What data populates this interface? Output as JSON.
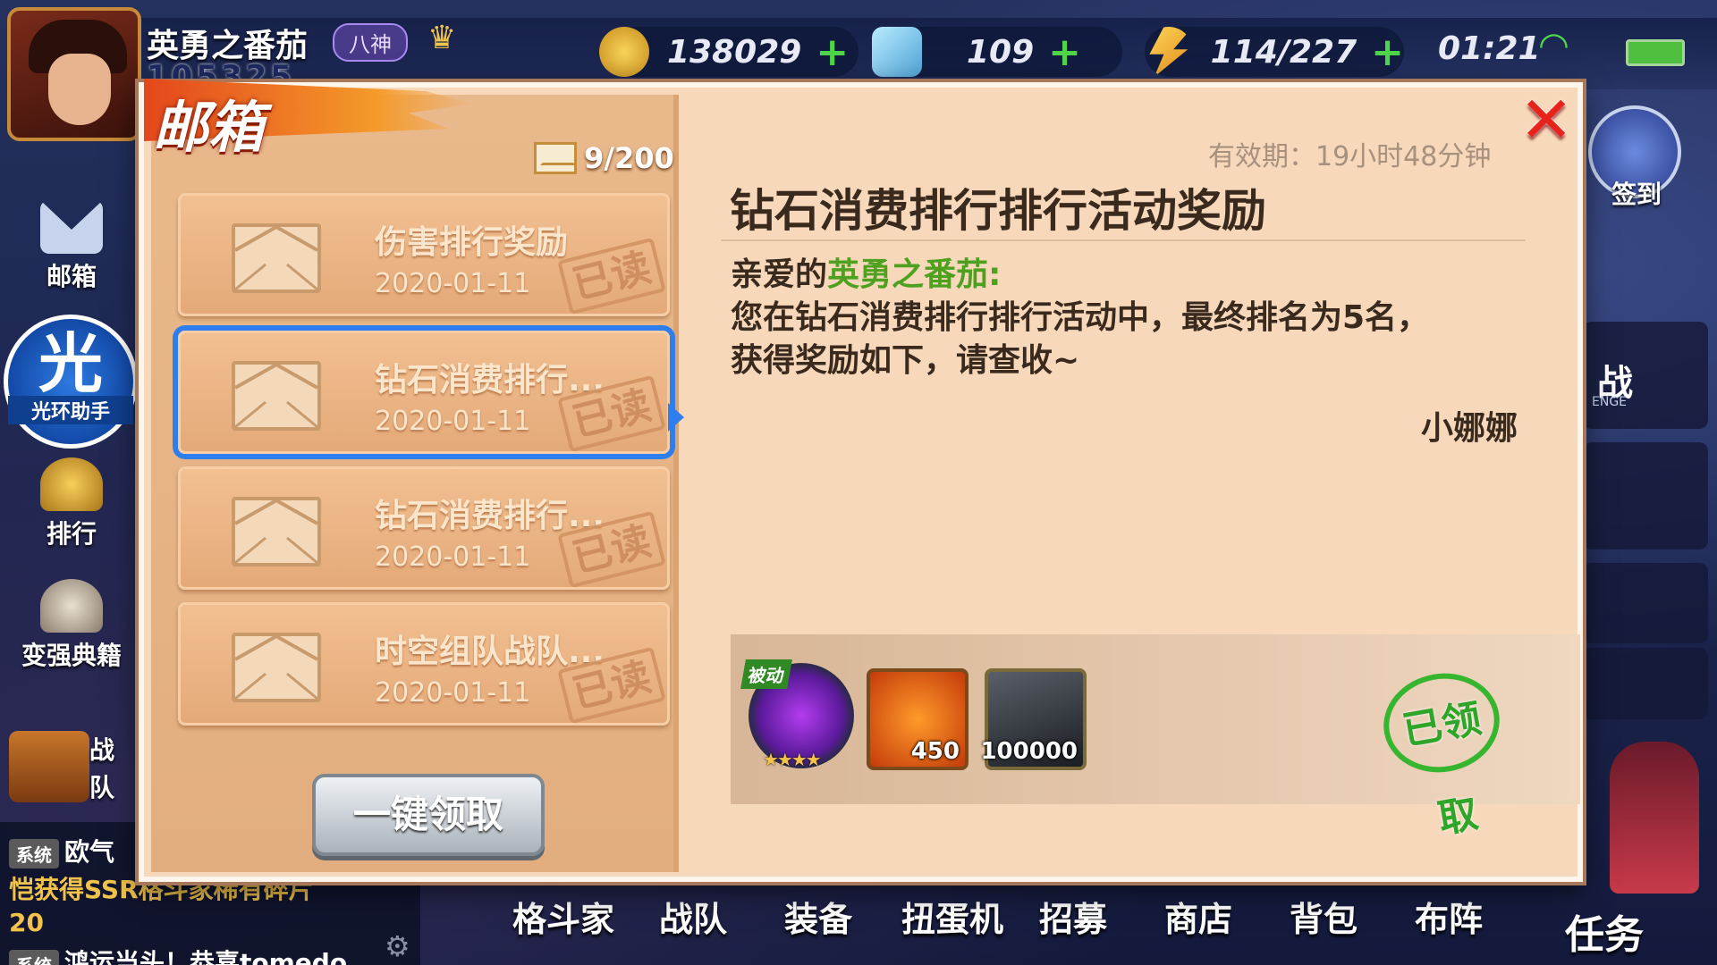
{
  "status_bar": {
    "player_name": "英勇之番茄",
    "vip_badge": "八神",
    "level_text": "105325",
    "gold": "138029",
    "diamond": "109",
    "stamina": "114/227",
    "plus": "+",
    "time": "01:21"
  },
  "sidebar": {
    "mailbox": "邮箱",
    "halo_big": "光",
    "halo_label": "光环助手",
    "ranking": "排行",
    "guide": "变强典籍",
    "battle": "战",
    "team": "队"
  },
  "right_side": {
    "signin": "签到",
    "challenge": "战",
    "challenge_sub": "ENGE",
    "task": "任务"
  },
  "chat": {
    "sys1_tag": "系统",
    "sys1_text": "欧气",
    "line2": "恺获得SSR格斗家稀有碎片",
    "line3": "20",
    "sys2_tag": "系统",
    "sys2_text": "鸿运当头！恭喜tomedo"
  },
  "bottom_nav": [
    "格斗家",
    "战队",
    "装备",
    "扭蛋机",
    "招募",
    "商店",
    "背包",
    "布阵"
  ],
  "dialog": {
    "header": "邮箱",
    "mail_count": "9/200",
    "claim_all": "一键领取",
    "close_icon": "✕",
    "mails": [
      {
        "title": "伤害排行奖励",
        "date": "2020-01-11",
        "status": "已读"
      },
      {
        "title": "钻石消费排行...",
        "date": "2020-01-11",
        "status": "已读"
      },
      {
        "title": "钻石消费排行...",
        "date": "2020-01-11",
        "status": "已读"
      },
      {
        "title": "时空组队战队...",
        "date": "2020-01-11",
        "status": "已读"
      }
    ],
    "detail": {
      "expiry": "有效期：19小时48分钟",
      "title": "钻石消费排行排行活动奖励",
      "greeting_prefix": "亲爱的",
      "greeting_name": "英勇之番茄",
      "greeting_suffix": ":",
      "line1": "您在钻石消费排行排行活动中，最终排名为5名，",
      "line2": "获得奖励如下，请查收~",
      "sender": "小娜娜",
      "reward_passive_tag": "被动",
      "reward_stars": "★★★★",
      "reward_crystal_count": "450",
      "reward_gold_count": "100000",
      "claimed_stamp": "已领取"
    }
  }
}
